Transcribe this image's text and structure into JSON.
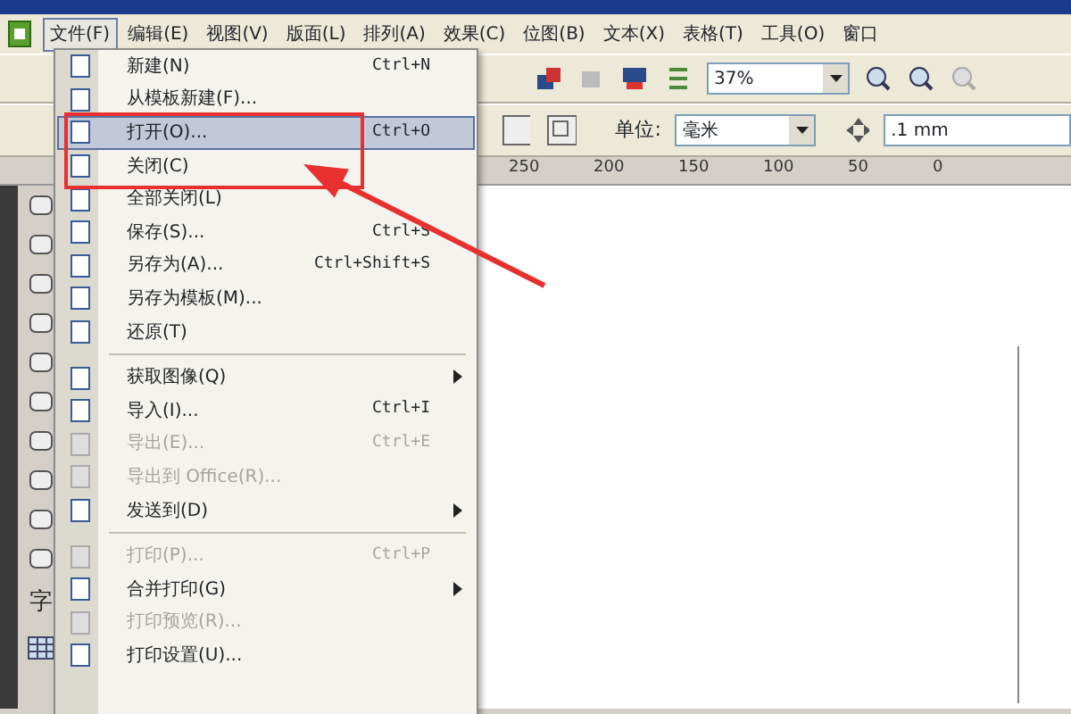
{
  "menubar": [
    {
      "label": "文件(F)",
      "selected": true
    },
    {
      "label": "编辑(E)",
      "selected": false
    },
    {
      "label": "视图(V)",
      "selected": false
    },
    {
      "label": "版面(L)",
      "selected": false
    },
    {
      "label": "排列(A)",
      "selected": false
    },
    {
      "label": "效果(C)",
      "selected": false
    },
    {
      "label": "位图(B)",
      "selected": false
    },
    {
      "label": "文本(X)",
      "selected": false
    },
    {
      "label": "表格(T)",
      "selected": false
    },
    {
      "label": "工具(O)",
      "selected": false
    },
    {
      "label": "窗口",
      "selected": false
    }
  ],
  "toolbar": {
    "zoom": "37%",
    "unit_label": "单位:",
    "unit": "毫米",
    "nudge": ".1 mm"
  },
  "ruler": [
    "250",
    "200",
    "150",
    "100",
    "50",
    "0"
  ],
  "toolbox_text_tool": "字",
  "file_menu": [
    {
      "kind": "item",
      "label": "新建(N)",
      "shortcut": "Ctrl+N",
      "disabled": false,
      "selected": false,
      "submenu": false
    },
    {
      "kind": "item",
      "label": "从模板新建(F)...",
      "disabled": false,
      "selected": false,
      "submenu": false
    },
    {
      "kind": "item",
      "label": "打开(O)...",
      "shortcut": "Ctrl+O",
      "disabled": false,
      "selected": true,
      "submenu": false
    },
    {
      "kind": "item",
      "label": "关闭(C)",
      "disabled": false,
      "selected": false,
      "submenu": false
    },
    {
      "kind": "item",
      "label": "全部关闭(L)",
      "disabled": false,
      "selected": false,
      "submenu": false
    },
    {
      "kind": "item",
      "label": "保存(S)...",
      "shortcut": "Ctrl+S",
      "disabled": false,
      "selected": false,
      "submenu": false
    },
    {
      "kind": "item",
      "label": "另存为(A)...",
      "shortcut": "Ctrl+Shift+S",
      "disabled": false,
      "selected": false,
      "submenu": false
    },
    {
      "kind": "item",
      "label": "另存为模板(M)...",
      "disabled": false,
      "selected": false,
      "submenu": false
    },
    {
      "kind": "item",
      "label": "还原(T)",
      "disabled": false,
      "selected": false,
      "submenu": false
    },
    {
      "kind": "separator"
    },
    {
      "kind": "item",
      "label": "获取图像(Q)",
      "disabled": false,
      "selected": false,
      "submenu": true
    },
    {
      "kind": "item",
      "label": "导入(I)...",
      "shortcut": "Ctrl+I",
      "disabled": false,
      "selected": false,
      "submenu": false
    },
    {
      "kind": "item",
      "label": "导出(E)...",
      "shortcut": "Ctrl+E",
      "disabled": true,
      "selected": false,
      "submenu": false
    },
    {
      "kind": "item",
      "label": "导出到 Office(R)...",
      "disabled": true,
      "selected": false,
      "submenu": false
    },
    {
      "kind": "item",
      "label": "发送到(D)",
      "disabled": false,
      "selected": false,
      "submenu": true
    },
    {
      "kind": "separator"
    },
    {
      "kind": "item",
      "label": "打印(P)...",
      "shortcut": "Ctrl+P",
      "disabled": true,
      "selected": false,
      "submenu": false
    },
    {
      "kind": "item",
      "label": "合并打印(G)",
      "disabled": false,
      "selected": false,
      "submenu": true
    },
    {
      "kind": "item",
      "label": "打印预览(R)...",
      "disabled": true,
      "selected": false,
      "submenu": false
    },
    {
      "kind": "item",
      "label": "打印设置(U)...",
      "disabled": false,
      "selected": false,
      "submenu": false
    }
  ]
}
